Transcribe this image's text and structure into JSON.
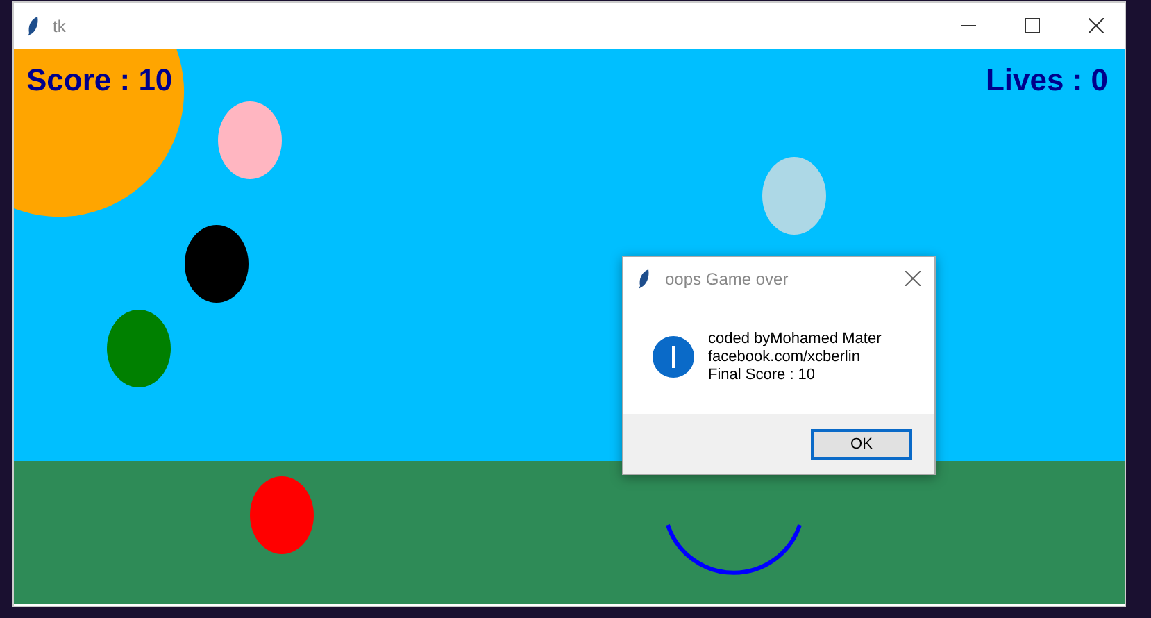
{
  "window": {
    "title": "tk"
  },
  "game": {
    "score": "Score : 10",
    "lives": "Lives : 0",
    "balls": [
      {
        "color": "#ffb6c1"
      },
      {
        "color": "#add8e6"
      },
      {
        "color": "#000000"
      },
      {
        "color": "#008000"
      },
      {
        "color": "#ff0000"
      }
    ]
  },
  "dialog": {
    "title": "oops Game over",
    "lines": [
      "coded byMohamed Mater",
      "facebook.com/xcberlin",
      "Final Score : 10"
    ],
    "button": "OK"
  }
}
